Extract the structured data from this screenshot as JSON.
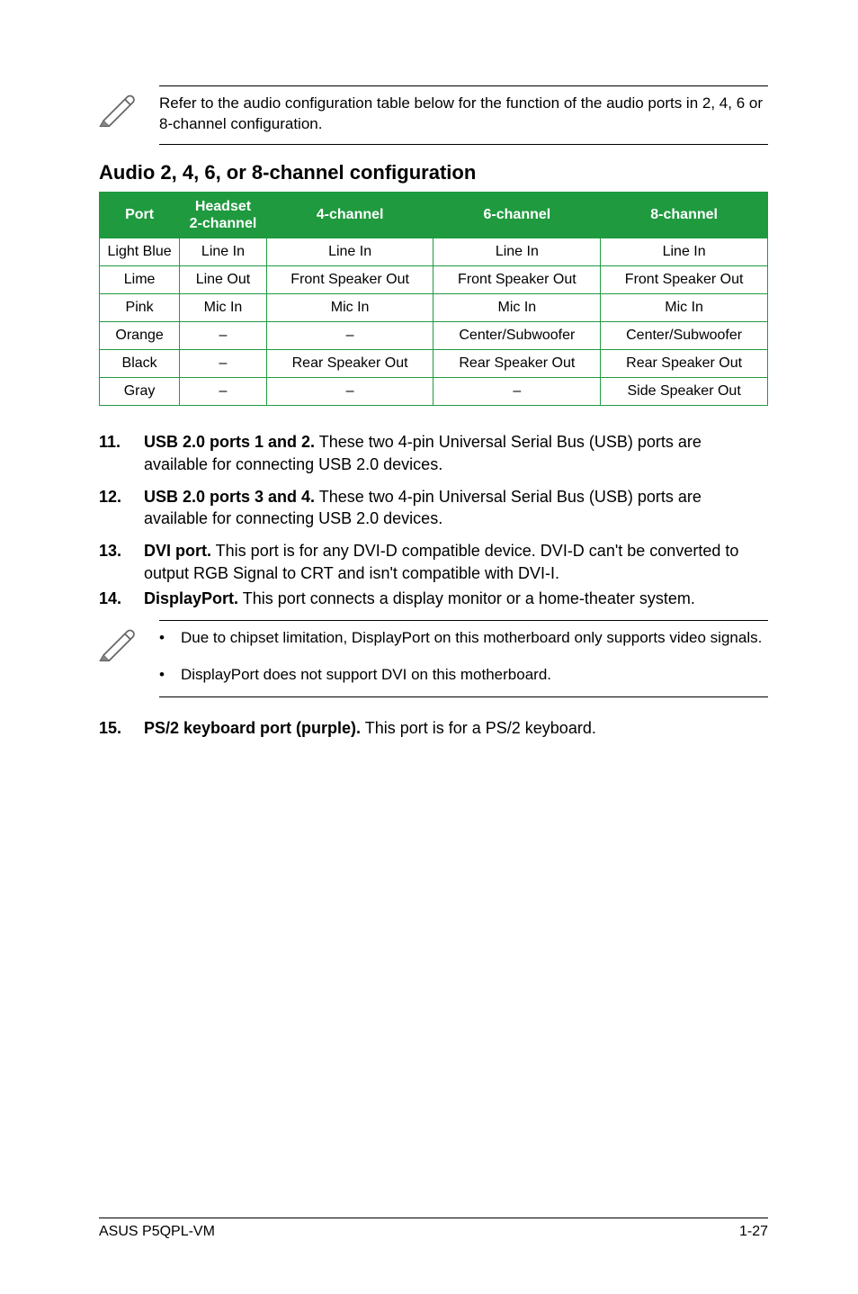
{
  "note1": "Refer to the audio configuration table below for the function of the audio ports in 2, 4, 6 or 8-channel configuration.",
  "section_title": "Audio 2, 4, 6, or 8-channel configuration",
  "table": {
    "headers": [
      "Port",
      "Headset\n2-channel",
      "4-channel",
      "6-channel",
      "8-channel"
    ],
    "rows": [
      [
        "Light Blue",
        "Line In",
        "Line In",
        "Line In",
        "Line In"
      ],
      [
        "Lime",
        "Line Out",
        "Front Speaker Out",
        "Front Speaker Out",
        "Front Speaker Out"
      ],
      [
        "Pink",
        "Mic In",
        "Mic In",
        "Mic In",
        "Mic In"
      ],
      [
        "Orange",
        "–",
        "–",
        "Center/Subwoofer",
        "Center/Subwoofer"
      ],
      [
        "Black",
        "–",
        "Rear Speaker Out",
        "Rear Speaker Out",
        "Rear Speaker Out"
      ],
      [
        "Gray",
        "–",
        "–",
        "–",
        "Side Speaker Out"
      ]
    ]
  },
  "items": [
    {
      "num": "11.",
      "bold": "USB 2.0 ports 1 and 2.",
      "text": " These two 4-pin Universal Serial Bus (USB) ports are available for connecting USB 2.0 devices."
    },
    {
      "num": "12.",
      "bold": "USB 2.0 ports 3 and 4.",
      "text": " These two 4-pin Universal Serial Bus (USB) ports are available for connecting USB 2.0 devices."
    },
    {
      "num": "13.",
      "bold": "DVI port.",
      "text": " This port is for any DVI-D compatible device. DVI-D can't be converted to output RGB  Signal to CRT and isn't compatible with DVI-I."
    },
    {
      "num": "14.",
      "bold": "DisplayPort.",
      "text": " This port connects a display monitor or a home-theater system."
    }
  ],
  "note2_bullets": [
    "Due to chipset limitation, DisplayPort on this motherboard only supports video signals.",
    "DisplayPort does not support DVI on this motherboard."
  ],
  "item15": {
    "num": "15.",
    "bold": "PS/2 keyboard port (purple).",
    "text": " This port is for a PS/2 keyboard."
  },
  "footer_left": "ASUS P5QPL-VM",
  "footer_right": "1-27"
}
